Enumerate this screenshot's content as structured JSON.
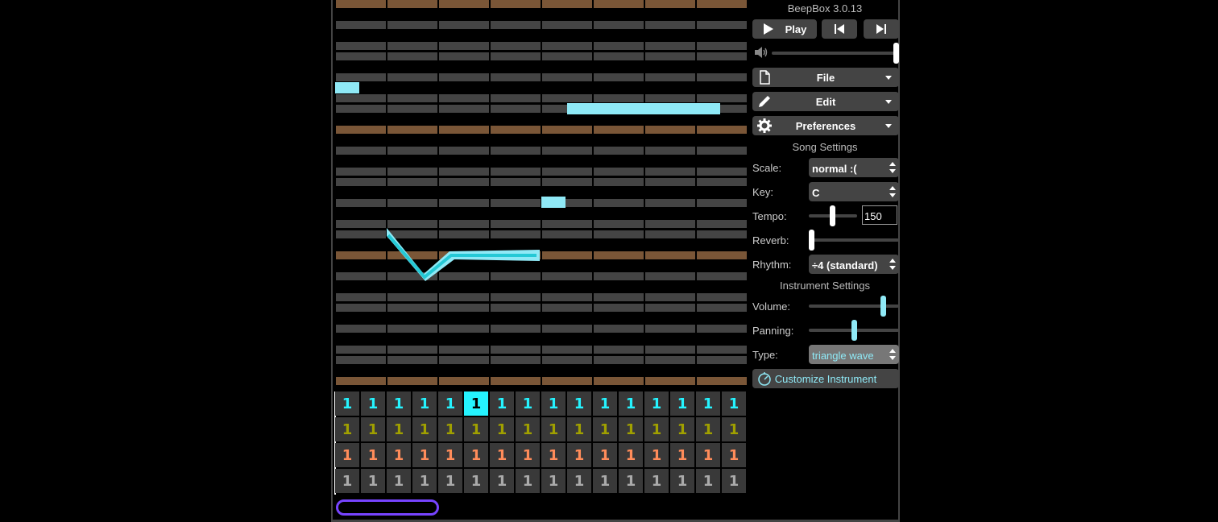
{
  "app": {
    "title": "BeepBox 3.0.13"
  },
  "transport": {
    "play_label": "Play"
  },
  "menus": {
    "file": "File",
    "edit": "Edit",
    "preferences": "Preferences"
  },
  "song_settings": {
    "title": "Song Settings",
    "scale": {
      "label": "Scale:",
      "value": "normal :("
    },
    "key": {
      "label": "Key:",
      "value": "C"
    },
    "tempo": {
      "label": "Tempo:",
      "value": "150"
    },
    "reverb": {
      "label": "Reverb:",
      "level": 0
    },
    "rhythm": {
      "label": "Rhythm:",
      "value": "÷4 (standard)"
    }
  },
  "instrument_settings": {
    "title": "Instrument Settings",
    "volume": {
      "label": "Volume:",
      "level": 0.85
    },
    "panning": {
      "label": "Panning:",
      "level": 0.5
    },
    "type": {
      "label": "Type:",
      "value": "triangle wave"
    },
    "customize_label": "Customize Instrument"
  },
  "master_volume_level": 1.0,
  "colors": {
    "note": "#8fe9f6",
    "octave_row": "#7a5637",
    "grid_row": "#444444",
    "selected_pattern": "#25f3ff",
    "channel_colors": [
      "#25f3ff",
      "#a0a000",
      "#ff8c5a",
      "#aaaaaa"
    ],
    "loop_handle": "#7744ff"
  },
  "pattern_grid": {
    "channels": [
      {
        "cells": [
          "1",
          "1",
          "1",
          "1",
          "1",
          "1",
          "1",
          "1",
          "1",
          "1",
          "1",
          "1",
          "1",
          "1",
          "1",
          "1"
        ],
        "selected": 5
      },
      {
        "cells": [
          "1",
          "1",
          "1",
          "1",
          "1",
          "1",
          "1",
          "1",
          "1",
          "1",
          "1",
          "1",
          "1",
          "1",
          "1",
          "1"
        ]
      },
      {
        "cells": [
          "1",
          "1",
          "1",
          "1",
          "1",
          "1",
          "1",
          "1",
          "1",
          "1",
          "1",
          "1",
          "1",
          "1",
          "1",
          "1"
        ]
      },
      {
        "cells": [
          "1",
          "1",
          "1",
          "1",
          "1",
          "1",
          "1",
          "1",
          "1",
          "1",
          "1",
          "1",
          "1",
          "1",
          "1",
          "1"
        ]
      }
    ]
  },
  "icons": {
    "play": "play-icon",
    "prev": "prev-bar-icon",
    "next": "next-bar-icon",
    "volume": "speaker-icon",
    "file": "file-icon",
    "edit": "pencil-icon",
    "preferences": "gear-icon",
    "customize": "dial-icon"
  }
}
